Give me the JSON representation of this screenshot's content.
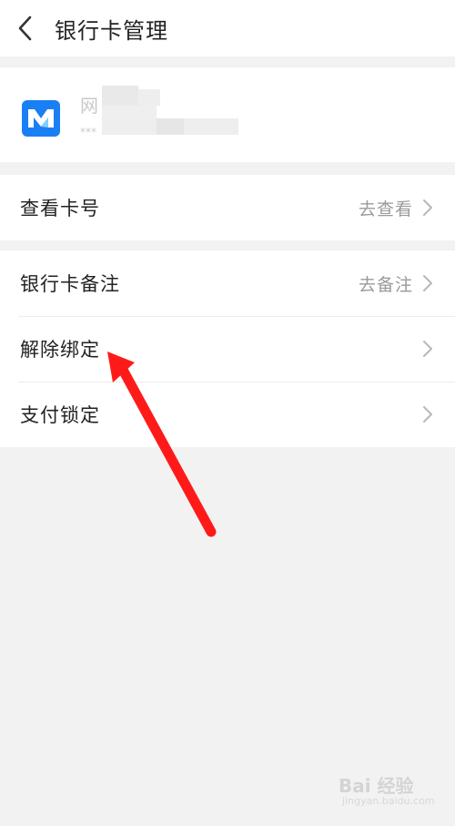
{
  "header": {
    "title": "银行卡管理",
    "back_icon": "chevron-left-icon"
  },
  "card": {
    "bank_name_partial": "网",
    "card_number_partial": "***",
    "logo_icon": "bank-logo-icon",
    "logo_color": "#1a7ff5"
  },
  "section1": {
    "rows": [
      {
        "label": "查看卡号",
        "action": "去查看"
      }
    ]
  },
  "section2": {
    "rows": [
      {
        "label": "银行卡备注",
        "action": "去备注"
      },
      {
        "label": "解除绑定",
        "action": ""
      },
      {
        "label": "支付锁定",
        "action": ""
      }
    ]
  },
  "annotation": {
    "arrow_color": "#ff1a1a"
  },
  "watermark": {
    "text": "Bai 经验",
    "sub": "jingyan.baidu.com"
  }
}
